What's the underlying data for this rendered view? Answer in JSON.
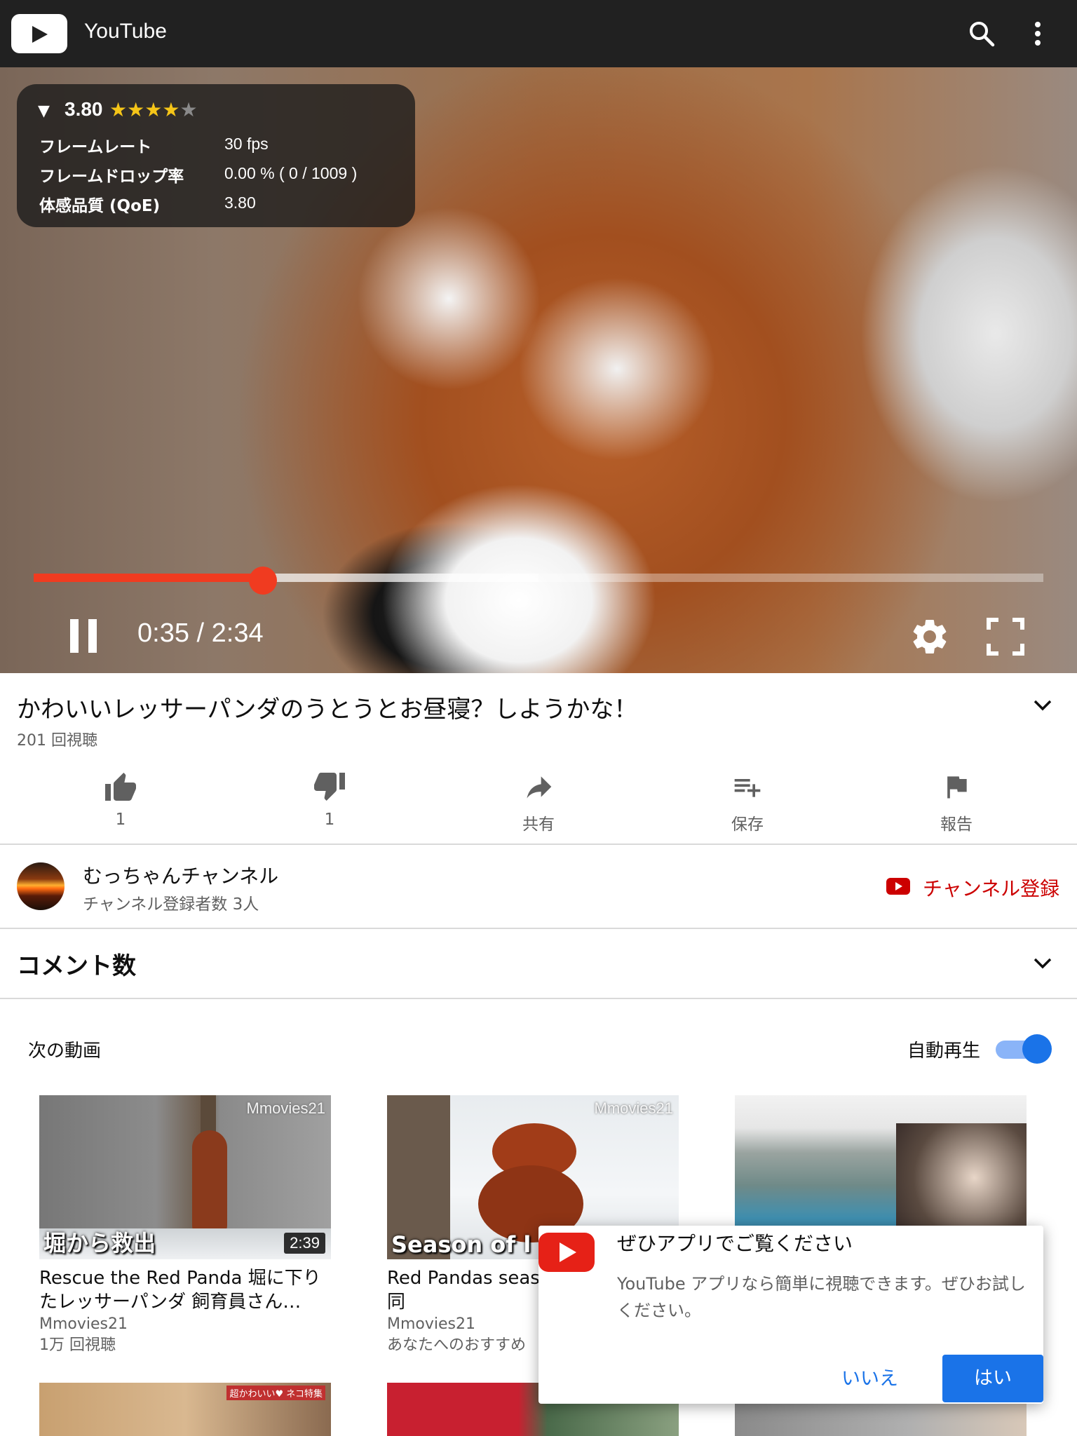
{
  "app": {
    "title": "YouTube"
  },
  "player": {
    "stats": {
      "score": "3.80",
      "stars_filled": 4,
      "stars_total": 5,
      "rows": [
        {
          "label": "フレームレート",
          "value": "30 fps"
        },
        {
          "label": "フレームドロップ率",
          "value": "0.00 % ( 0 / 1009 )"
        },
        {
          "label": "体感品質 (QoE)",
          "value": "3.80"
        }
      ]
    },
    "time": "0:35 / 2:34",
    "progress_fraction": 0.2273,
    "buffered_fraction": 0.5,
    "accent_color": "#f03b20"
  },
  "video": {
    "title": "かわいいレッサーパンダのうとうとお昼寝？しようかな！",
    "views": "201 回視聴",
    "actions": [
      {
        "icon": "thumbs-up-icon",
        "label": "1"
      },
      {
        "icon": "thumbs-down-icon",
        "label": "1"
      },
      {
        "icon": "share-icon",
        "label": "共有"
      },
      {
        "icon": "add-to-playlist-icon",
        "label": "保存"
      },
      {
        "icon": "flag-icon",
        "label": "報告"
      }
    ]
  },
  "channel": {
    "name": "むっちゃんチャンネル",
    "subscribers": "チャンネル登録者数 3人",
    "subscribe_label": "チャンネル登録",
    "subscribe_color": "#cc0000"
  },
  "comments": {
    "title": "コメント数"
  },
  "up_next": {
    "title": "次の動画",
    "autoplay_label": "自動再生",
    "autoplay_on": true,
    "videos": [
      {
        "channel_watermark": "Mmovies21",
        "overlay_title": "堀から救出",
        "duration": "2:39",
        "title": "Rescue the Red Panda 堀に下りたレッサーパンダ 飼育員さん…",
        "channel": "Mmovies21",
        "meta": "1万 回視聴"
      },
      {
        "channel_watermark": "Mmovies21",
        "overlay_title": "Season of l",
        "duration": "",
        "title": "Red Pandas seas エイタとギンの同",
        "channel": "Mmovies21",
        "meta": "あなたへのおすすめ"
      },
      {
        "channel_watermark": "",
        "overlay_title": "",
        "duration": "",
        "title": "",
        "channel": "",
        "meta": ""
      }
    ],
    "second_row_badge": "超かわいい♥ ネコ特集"
  },
  "dialog": {
    "title": "ぜひアプリでご覧ください",
    "body": "YouTube アプリなら簡単に視聴できます。ぜひお試しください。",
    "no_label": "いいえ",
    "yes_label": "はい",
    "button_color": "#1a73e8"
  }
}
